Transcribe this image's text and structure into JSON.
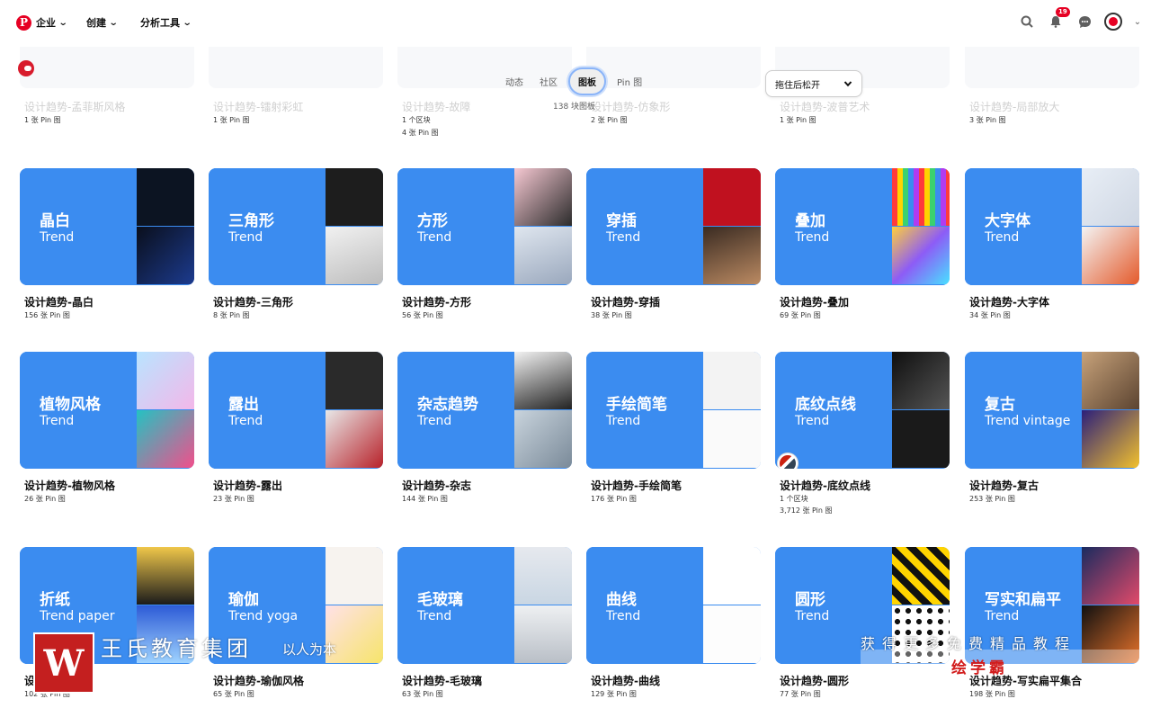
{
  "nav": {
    "logo": "P",
    "items": [
      "企业",
      "创建",
      "分析工具"
    ],
    "notifications": "19"
  },
  "tabs": [
    "动态",
    "社区",
    "图板",
    "Pin 图"
  ],
  "active_tab": "图板",
  "board_count": "138 块图板",
  "sort": {
    "label": "拖住后松开"
  },
  "ghost_boards": [
    {
      "title": "设计趋势-孟菲斯风格",
      "meta": [
        "1 张 Pin 图"
      ]
    },
    {
      "title": "设计趋势-镭射彩虹",
      "meta": [
        "1 张 Pin 图"
      ]
    },
    {
      "title": "设计趋势-故障",
      "meta": [
        "1 个区块",
        "4 张 Pin 图"
      ]
    },
    {
      "title": "设计趋势-仿象形",
      "meta": [
        "2 张 Pin 图"
      ]
    },
    {
      "title": "设计趋势-波普艺术",
      "meta": [
        "1 张 Pin 图"
      ]
    },
    {
      "title": "设计趋势-局部放大",
      "meta": [
        "3 张 Pin 图"
      ]
    }
  ],
  "boards": [
    {
      "cover_title": "晶白",
      "cover_sub": "Trend",
      "name": "设计趋势-晶白",
      "meta": [
        "156 张 Pin 图"
      ]
    },
    {
      "cover_title": "三角形",
      "cover_sub": "Trend",
      "name": "设计趋势-三角形",
      "meta": [
        "8 张 Pin 图"
      ]
    },
    {
      "cover_title": "方形",
      "cover_sub": "Trend",
      "name": "设计趋势-方形",
      "meta": [
        "56 张 Pin 图"
      ]
    },
    {
      "cover_title": "穿插",
      "cover_sub": "Trend",
      "name": "设计趋势-穿插",
      "meta": [
        "38 张 Pin 图"
      ]
    },
    {
      "cover_title": "叠加",
      "cover_sub": "Trend",
      "name": "设计趋势-叠加",
      "meta": [
        "69 张 Pin 图"
      ]
    },
    {
      "cover_title": "大字体",
      "cover_sub": "Trend",
      "name": "设计趋势-大字体",
      "meta": [
        "34 张 Pin 图"
      ]
    },
    {
      "cover_title": "植物风格",
      "cover_sub": "Trend",
      "name": "设计趋势-植物风格",
      "meta": [
        "26 张 Pin 图"
      ]
    },
    {
      "cover_title": "露出",
      "cover_sub": "Trend",
      "name": "设计趋势-露出",
      "meta": [
        "23 张 Pin 图"
      ]
    },
    {
      "cover_title": "杂志趋势",
      "cover_sub": "Trend",
      "name": "设计趋势-杂志",
      "meta": [
        "144 张 Pin 图"
      ]
    },
    {
      "cover_title": "手绘简笔",
      "cover_sub": "Trend",
      "name": "设计趋势-手绘简笔",
      "meta": [
        "176 张 Pin 图"
      ]
    },
    {
      "cover_title": "底纹点线",
      "cover_sub": "Trend",
      "name": "设计趋势-底纹点线",
      "meta": [
        "1 个区块",
        "3,712 张 Pin 图"
      ]
    },
    {
      "cover_title": "复古",
      "cover_sub": "Trend vintage",
      "name": "设计趋势-复古",
      "meta": [
        "253 张 Pin 图"
      ]
    },
    {
      "cover_title": "折纸",
      "cover_sub": "Trend paper",
      "name": "设计趋势-折纸",
      "meta": [
        "102 张 Pin 图"
      ]
    },
    {
      "cover_title": "瑜伽",
      "cover_sub": "Trend yoga",
      "name": "设计趋势-瑜伽风格",
      "meta": [
        "65 张 Pin 图"
      ]
    },
    {
      "cover_title": "毛玻璃",
      "cover_sub": "Trend",
      "name": "设计趋势-毛玻璃",
      "meta": [
        "63 张 Pin 图"
      ]
    },
    {
      "cover_title": "曲线",
      "cover_sub": "Trend",
      "name": "设计趋势-曲线",
      "meta": [
        "129 张 Pin 图"
      ]
    },
    {
      "cover_title": "圆形",
      "cover_sub": "Trend",
      "name": "设计趋势-圆形",
      "meta": [
        "77 张 Pin 图"
      ]
    },
    {
      "cover_title": "写实和扁平",
      "cover_sub": "Trend",
      "name": "设计趋势-写实扁平集合",
      "meta": [
        "198 张 Pin 图"
      ]
    }
  ],
  "watermark": {
    "logo": "W",
    "org": "王氏教育集团",
    "slogan": "以人为本",
    "right_top": "获得更多免费精品教程",
    "right_brand": "绘学霸"
  },
  "colors": {
    "cover_blue": "#3b8cf0",
    "brand_red": "#e60023"
  }
}
